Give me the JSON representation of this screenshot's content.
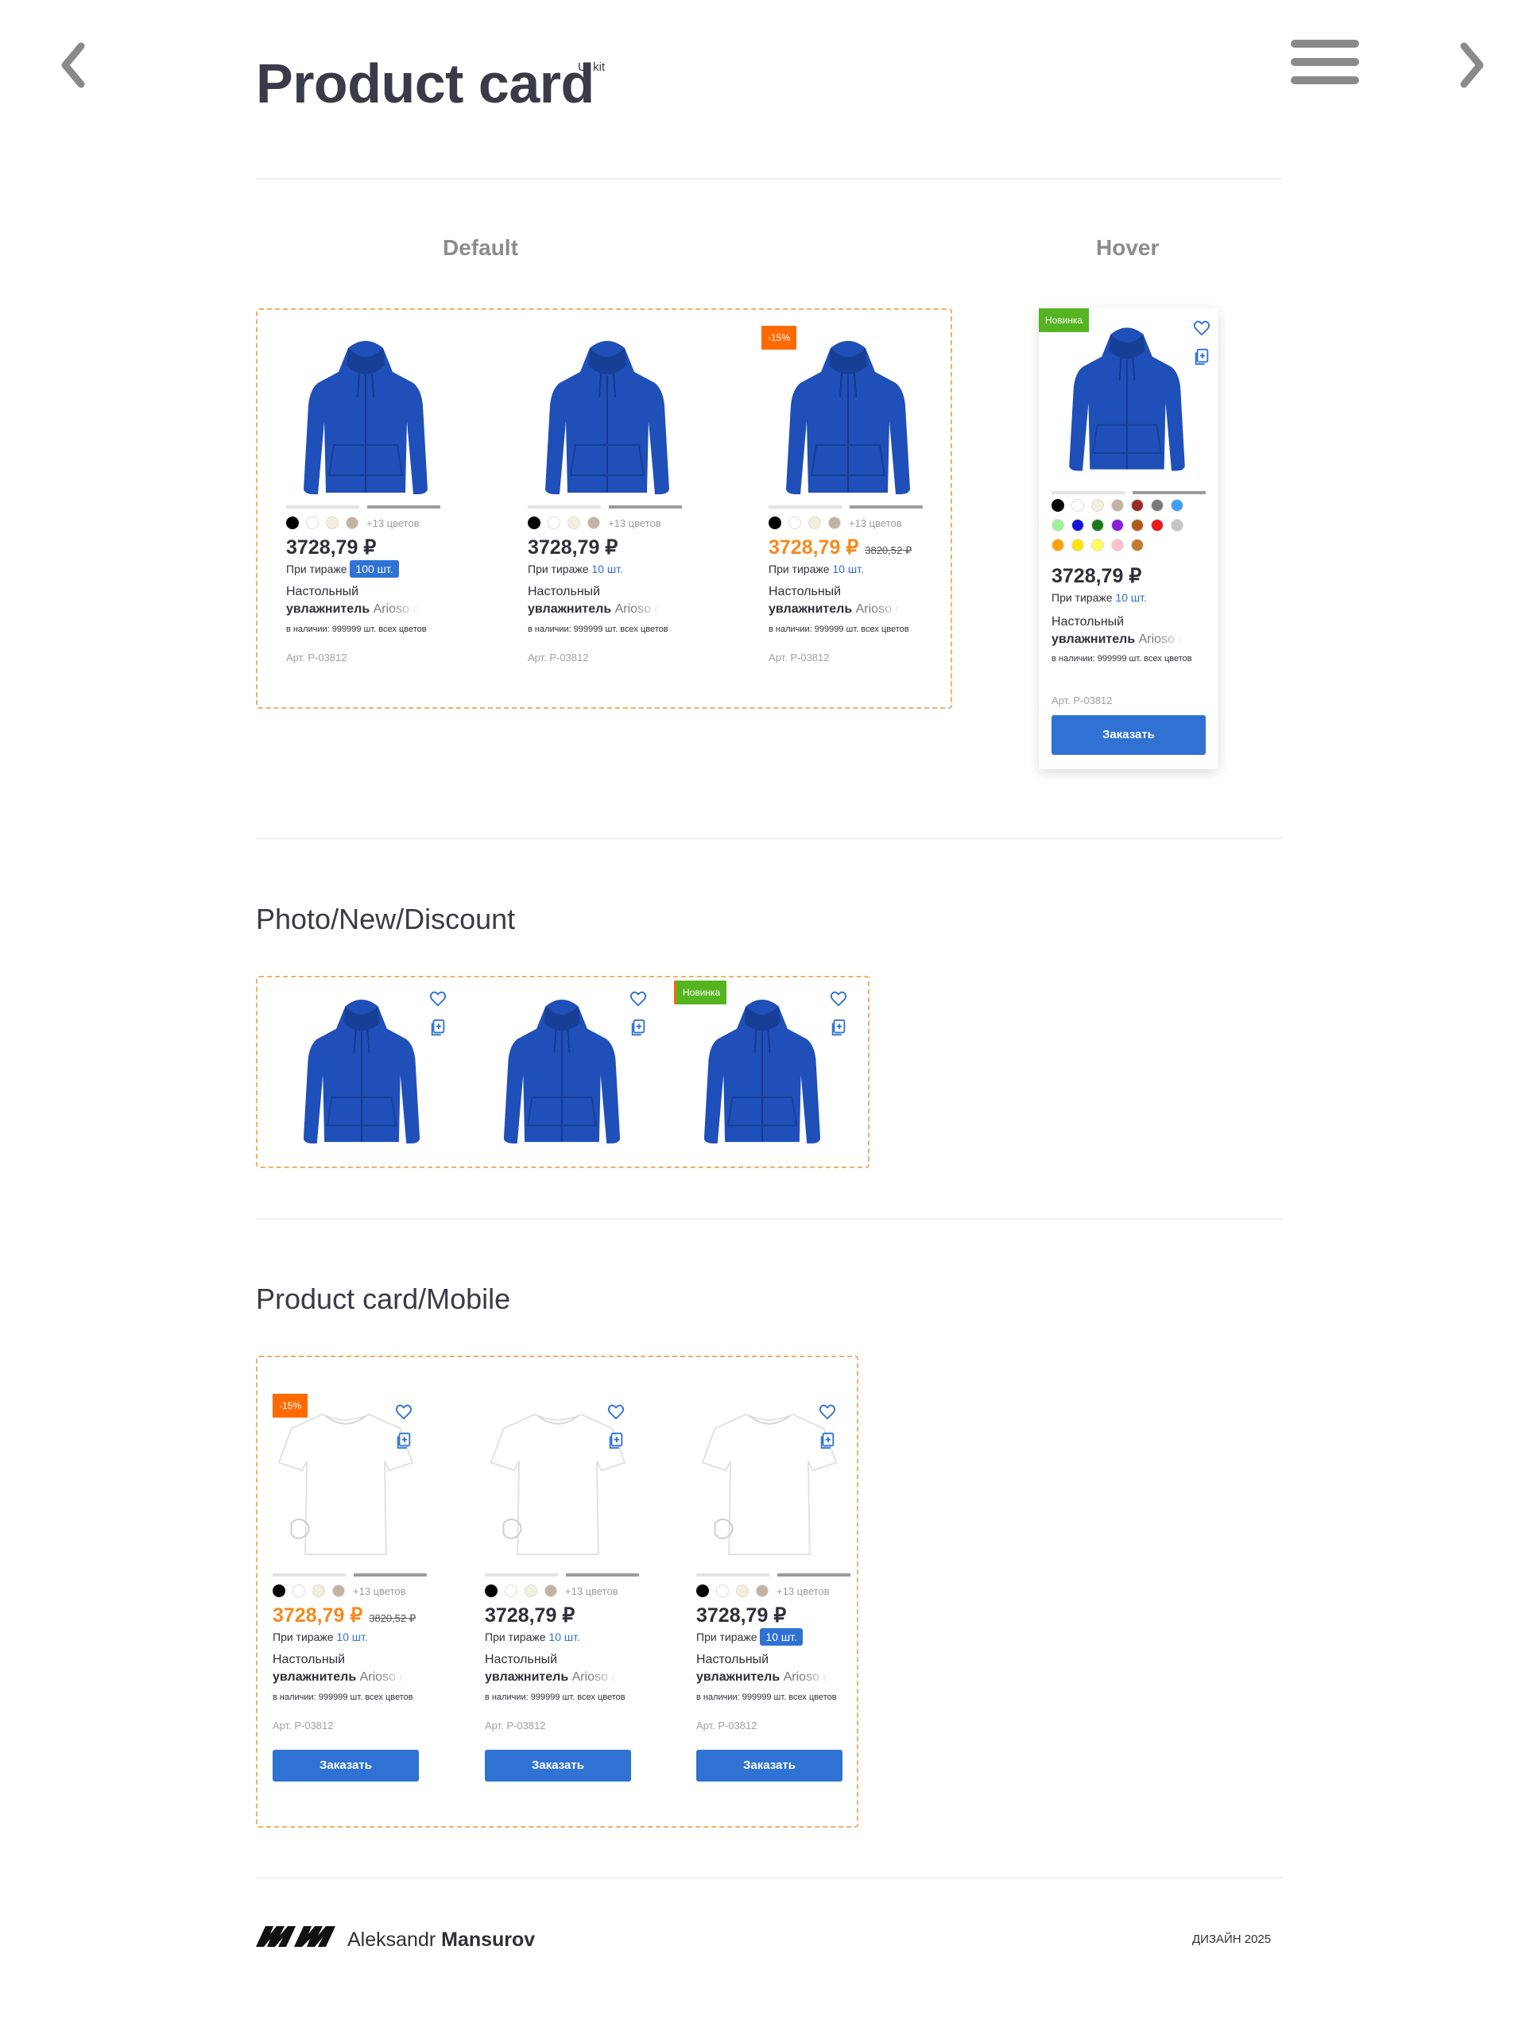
{
  "header": {
    "title": "Product card",
    "sup": "UI kit"
  },
  "labels": {
    "default": "Default",
    "hover": "Hover",
    "section_photo": "Photo/New/Discount",
    "section_mobile": "Product card/Mobile"
  },
  "card_common": {
    "price": "3728,79 ₽",
    "old_price": "3820,52 ₽",
    "circulation_label": "При тираже",
    "more_colors": "+13 цветов",
    "name_line1": "Настольный",
    "name_line2_bold": "увлажнитель",
    "name_line2_rest": "Arioso с",
    "stock_line": "в наличии: 999999 шт. всех цветов",
    "article": "Арт. P-03812",
    "order_button": "Заказать",
    "badge_discount": "-15%",
    "badge_new": "Новинка"
  },
  "default_cards": [
    {
      "qty": "100 шт.",
      "qty_pill": true,
      "sale": false
    },
    {
      "qty": "10 шт.",
      "qty_pill": false,
      "sale": false
    },
    {
      "qty": "10 шт.",
      "qty_pill": false,
      "sale": true
    }
  ],
  "hover_card": {
    "qty": "10 шт.",
    "colors": [
      "#000000",
      "#ffffff",
      "#f2f0dc",
      "#c2b3a3",
      "#9b2a2a",
      "#7a7a7a",
      "#3ea0ff",
      "#9ff29b",
      "#1414d8",
      "#1a7a1a",
      "#8a1fd8",
      "#b35a1a",
      "#e81b1b",
      "#c4c4c4",
      "#ffa200",
      "#ffe400",
      "#ffff5a",
      "#ffc0cb",
      "#c77630"
    ]
  },
  "mobile_cards": [
    {
      "qty": "10 шт.",
      "qty_pill": false,
      "sale": true
    },
    {
      "qty": "10 шт.",
      "qty_pill": false,
      "sale": false
    },
    {
      "qty": "10 шт.",
      "qty_pill": true,
      "sale": false
    }
  ],
  "swatch_colors": [
    "#000000",
    "#ffffff",
    "#f2f0dc",
    "#c2b3a3"
  ],
  "colors": {
    "accent_blue": "#2f72d3",
    "sale_orange": "#f58a1f",
    "discount_badge": "#ff6a00",
    "new_badge": "#56b421",
    "dashed_border": "#f2ae6a",
    "hoodie_blue": "#1f4fb8"
  },
  "footer": {
    "name_light": "Aleksandr",
    "name_bold": "Mansurov",
    "year": "ДИЗАЙН 2025"
  }
}
